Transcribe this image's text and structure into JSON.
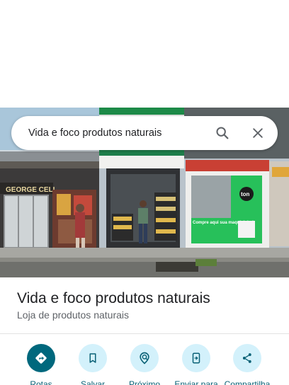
{
  "search": {
    "query": "Vida e foco produtos naturais",
    "search_icon": "search-icon",
    "close_icon": "close-icon"
  },
  "photo": {
    "shop_sign_left": "GEORGE CELL",
    "ton_logo": "ton",
    "ton_banner": "Compre aqui sua maquininha!"
  },
  "place": {
    "name": "Vida e foco produtos naturais",
    "category": "Loja de produtos naturais"
  },
  "actions": [
    {
      "label": "Rotas",
      "icon": "directions-icon"
    },
    {
      "label": "Salvar",
      "icon": "bookmark-icon"
    },
    {
      "label": "Próximo",
      "icon": "nearby-icon"
    },
    {
      "label": "Enviar para",
      "icon": "send-to-phone-icon"
    },
    {
      "label": "Compartilha",
      "icon": "share-icon"
    }
  ],
  "colors": {
    "primary_action": "#00687d",
    "action_bg": "#d3f1fb",
    "action_label": "#0b6277"
  }
}
